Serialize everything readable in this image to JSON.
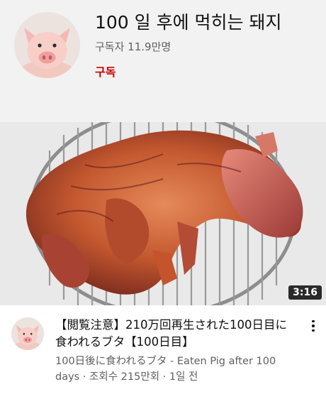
{
  "channel": {
    "title": "100 일 후에 먹히는 돼지",
    "subscribers": "구독자 11.9만명",
    "subscribe_label": "구독",
    "avatar_icon": "pig-face-icon"
  },
  "video": {
    "duration": "3:16",
    "title": "【閲覧注意】210万回再生された100日目に食われるブタ【100日目】",
    "meta": "100日後に食われるブタ  - Eaten Pig after 100 days · 조회수 215만회 · 1일 전",
    "thumbnail_icon": "roast-pig-thumbnail",
    "more_icon": "more-vert-icon"
  }
}
